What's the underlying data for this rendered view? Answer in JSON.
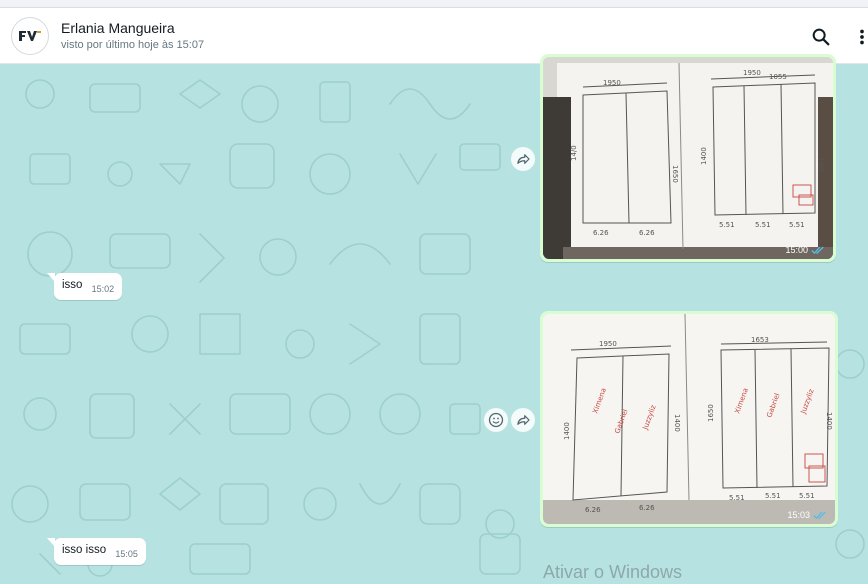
{
  "header": {
    "contact_name": "Erlania Mangueira",
    "status": "visto por último hoje às 15:07"
  },
  "messages": [
    {
      "type": "image",
      "direction": "out",
      "time": "15:00",
      "read": true
    },
    {
      "type": "text",
      "direction": "in",
      "text": "isso",
      "time": "15:02"
    },
    {
      "type": "image",
      "direction": "out",
      "time": "15:03",
      "read": true
    },
    {
      "type": "text",
      "direction": "in",
      "text": "isso isso",
      "time": "15:05"
    }
  ],
  "photo1": {
    "labels": [
      "1950",
      "14/0",
      "6.26",
      "6.26",
      "1650",
      "1400",
      "1950",
      "1055",
      "5.51",
      "5.51",
      "5.51",
      "14/0"
    ]
  },
  "photo2": {
    "labels": [
      "1950",
      "1400",
      "6.26",
      "6.26",
      "1400",
      "1650",
      "1653",
      "1400",
      "5.51",
      "5.51",
      "5.51",
      "Ximena",
      "Gabriel",
      "Juzzyliz",
      "Ximena",
      "Gabriel",
      "Juzzyliz"
    ]
  },
  "watermark": "Ativar o Windows",
  "colors": {
    "chat_bg": "#b6e3e1",
    "out_bubble": "#d9fdd3",
    "read_ticks": "#53bdeb"
  },
  "icons": [
    "search-icon",
    "menu-dots-icon",
    "forward-icon",
    "emoji-icon",
    "double-check-icon"
  ]
}
